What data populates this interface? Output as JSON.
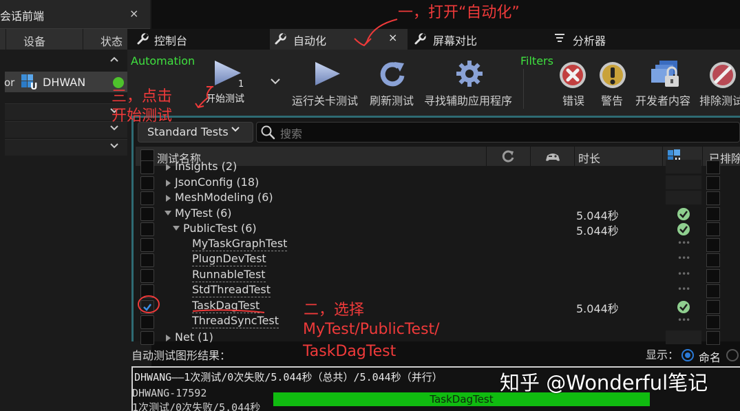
{
  "session_panel": {
    "tab_title": "会话前端",
    "tab_close": "×",
    "columns": {
      "device": "设备",
      "status": "状态"
    },
    "session": {
      "prefix": "or",
      "name": "DHWAN",
      "status_color": "#4ec12c"
    }
  },
  "tabs": [
    {
      "label": "控制台",
      "icon": "wrench-icon"
    },
    {
      "label": "自动化",
      "icon": "wrench-icon",
      "active": true,
      "close": "×"
    },
    {
      "label": "屏幕对比",
      "icon": "wrench-icon"
    },
    {
      "label": "分析器",
      "icon": "profiler-icon"
    }
  ],
  "toolbar": {
    "automation_label": "Automation",
    "filters_label": "Filters",
    "start_tests": {
      "label": "开始测试",
      "count": "1"
    },
    "run_level_tests": "运行关卡测试",
    "refresh_tests": "刷新测试",
    "find_helper_apps": "寻找辅助应用程序",
    "filter_errors": "错误",
    "filter_warnings": "警告",
    "developer_content": "开发者内容",
    "exclude_tests": "排除测试"
  },
  "search": {
    "group_selector": "Standard Tests",
    "placeholder": "搜索"
  },
  "table": {
    "columns": {
      "name": "测试名称",
      "duration": "时长",
      "excluded": "已排除"
    },
    "rows": [
      {
        "name": "Insights (2)",
        "level": 0,
        "expander": "collapsed",
        "checked": false
      },
      {
        "name": "JsonConfig (18)",
        "level": 0,
        "expander": "collapsed",
        "checked": false
      },
      {
        "name": "MeshModeling (6)",
        "level": 0,
        "expander": "collapsed",
        "checked": false
      },
      {
        "name": "MyTest (6)",
        "level": 0,
        "expander": "expanded",
        "checked": false,
        "duration": "5.044秒",
        "result": "success"
      },
      {
        "name": "PublicTest (6)",
        "level": 1,
        "expander": "expanded",
        "checked": false,
        "duration": "5.044秒",
        "result": "success"
      },
      {
        "name": "MyTaskGraphTest",
        "level": 2,
        "checked": false,
        "result": "none"
      },
      {
        "name": "PlugnDevTest",
        "level": 2,
        "checked": false,
        "result": "none"
      },
      {
        "name": "RunnableTest",
        "level": 2,
        "checked": false,
        "result": "none"
      },
      {
        "name": "StdThreadTest",
        "level": 2,
        "checked": false,
        "result": "none"
      },
      {
        "name": "TaskDagTest",
        "level": 2,
        "checked": true,
        "duration": "5.044秒",
        "result": "success"
      },
      {
        "name": "ThreadSyncTest",
        "level": 2,
        "checked": false,
        "result": "none"
      },
      {
        "name": "Net (1)",
        "level": 0,
        "expander": "collapsed",
        "checked": false
      }
    ]
  },
  "results": {
    "label": "自动测试图形结果：",
    "show_label": "显示：",
    "radio_name": "命名",
    "summary": "DHWANG——1次测试/0次失败/5.044秒（总共）/5.044秒（并行）",
    "device_id": "DHWANG-17592",
    "device_summary": "1次测试/0次失败/5.044秒",
    "bar_label": "TaskDagTest",
    "bar_color": "#10bb10"
  },
  "annotations": {
    "step1": "一，打开“自动化”",
    "step2_line1": "二，选择",
    "step2_line2": "MyTest/PublicTest/",
    "step2_line3": "TaskDagTest",
    "step3_line1": "三，点击",
    "step3_line2": "开始测试",
    "color": "#ef3a3a"
  },
  "watermark": "知乎 @Wonderful笔记"
}
